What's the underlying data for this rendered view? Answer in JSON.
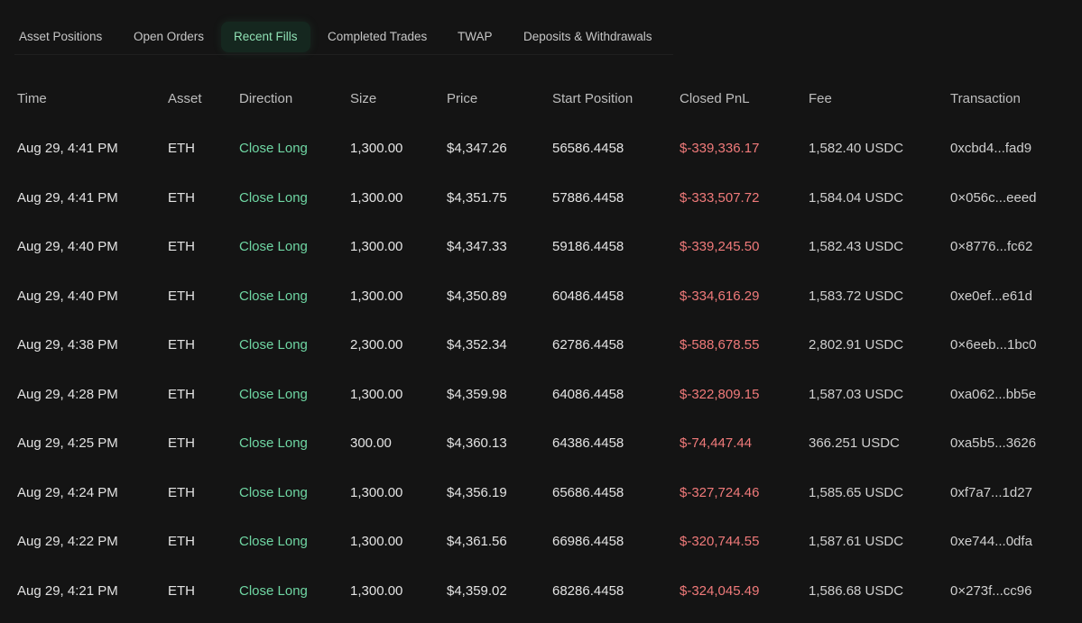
{
  "tabs": [
    {
      "label": "Asset Positions",
      "active": false
    },
    {
      "label": "Open Orders",
      "active": false
    },
    {
      "label": "Recent Fills",
      "active": true
    },
    {
      "label": "Completed Trades",
      "active": false
    },
    {
      "label": "TWAP",
      "active": false
    },
    {
      "label": "Deposits & Withdrawals",
      "active": false
    }
  ],
  "table": {
    "headers": {
      "time": "Time",
      "asset": "Asset",
      "direction": "Direction",
      "size": "Size",
      "price": "Price",
      "start_position": "Start Position",
      "closed_pnl": "Closed PnL",
      "fee": "Fee",
      "transaction": "Transaction"
    },
    "rows": [
      {
        "time": "Aug 29, 4:41 PM",
        "asset": "ETH",
        "direction": "Close Long",
        "size": "1,300.00",
        "price": "$4,347.26",
        "start_position": "56586.4458",
        "closed_pnl": "$-339,336.17",
        "fee": "1,582.40 USDC",
        "transaction": "0xcbd4...fad9"
      },
      {
        "time": "Aug 29, 4:41 PM",
        "asset": "ETH",
        "direction": "Close Long",
        "size": "1,300.00",
        "price": "$4,351.75",
        "start_position": "57886.4458",
        "closed_pnl": "$-333,507.72",
        "fee": "1,584.04 USDC",
        "transaction": "0×056c...eeed"
      },
      {
        "time": "Aug 29, 4:40 PM",
        "asset": "ETH",
        "direction": "Close Long",
        "size": "1,300.00",
        "price": "$4,347.33",
        "start_position": "59186.4458",
        "closed_pnl": "$-339,245.50",
        "fee": "1,582.43 USDC",
        "transaction": "0×8776...fc62"
      },
      {
        "time": "Aug 29, 4:40 PM",
        "asset": "ETH",
        "direction": "Close Long",
        "size": "1,300.00",
        "price": "$4,350.89",
        "start_position": "60486.4458",
        "closed_pnl": "$-334,616.29",
        "fee": "1,583.72 USDC",
        "transaction": "0xe0ef...e61d"
      },
      {
        "time": "Aug 29, 4:38 PM",
        "asset": "ETH",
        "direction": "Close Long",
        "size": "2,300.00",
        "price": "$4,352.34",
        "start_position": "62786.4458",
        "closed_pnl": "$-588,678.55",
        "fee": "2,802.91 USDC",
        "transaction": "0×6eeb...1bc0"
      },
      {
        "time": "Aug 29, 4:28 PM",
        "asset": "ETH",
        "direction": "Close Long",
        "size": "1,300.00",
        "price": "$4,359.98",
        "start_position": "64086.4458",
        "closed_pnl": "$-322,809.15",
        "fee": "1,587.03 USDC",
        "transaction": "0xa062...bb5e"
      },
      {
        "time": "Aug 29, 4:25 PM",
        "asset": "ETH",
        "direction": "Close Long",
        "size": "300.00",
        "price": "$4,360.13",
        "start_position": "64386.4458",
        "closed_pnl": "$-74,447.44",
        "fee": "366.251 USDC",
        "transaction": "0xa5b5...3626"
      },
      {
        "time": "Aug 29, 4:24 PM",
        "asset": "ETH",
        "direction": "Close Long",
        "size": "1,300.00",
        "price": "$4,356.19",
        "start_position": "65686.4458",
        "closed_pnl": "$-327,724.46",
        "fee": "1,585.65 USDC",
        "transaction": "0xf7a7...1d27"
      },
      {
        "time": "Aug 29, 4:22 PM",
        "asset": "ETH",
        "direction": "Close Long",
        "size": "1,300.00",
        "price": "$4,361.56",
        "start_position": "66986.4458",
        "closed_pnl": "$-320,744.55",
        "fee": "1,587.61 USDC",
        "transaction": "0xe744...0dfa"
      },
      {
        "time": "Aug 29, 4:21 PM",
        "asset": "ETH",
        "direction": "Close Long",
        "size": "1,300.00",
        "price": "$4,359.02",
        "start_position": "68286.4458",
        "closed_pnl": "$-324,045.49",
        "fee": "1,586.68 USDC",
        "transaction": "0×273f...cc96"
      }
    ]
  },
  "colors": {
    "background": "#141414",
    "active_tab_bg": "#15271f",
    "active_tab_text": "#8fe0b4",
    "direction_long": "#6fd6a3",
    "pnl_negative": "#f07a7a"
  }
}
